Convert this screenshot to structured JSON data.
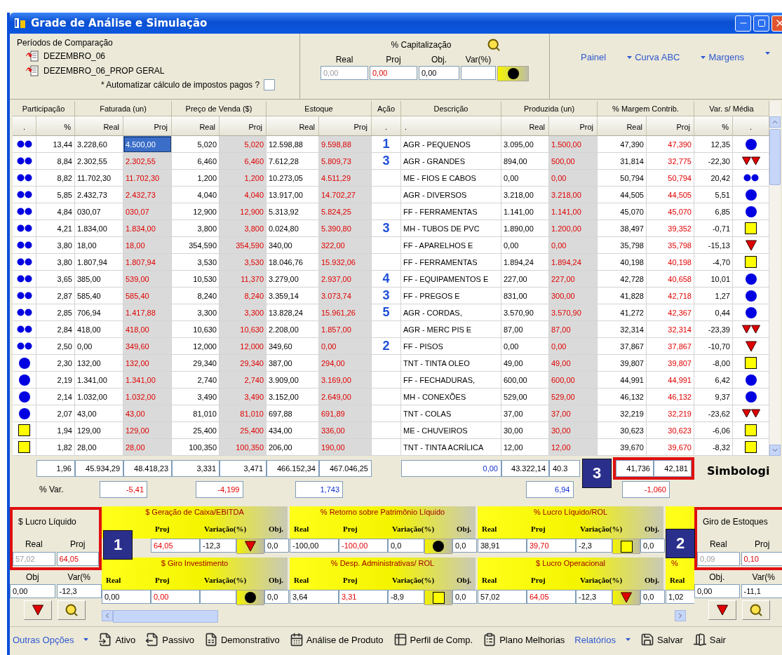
{
  "window": {
    "title": "Grade de Análise e Simulação"
  },
  "periods": {
    "title": "Períodos de Comparação",
    "items": [
      "DEZEMBRO_06",
      "DEZEMBRO_06_PROP GERAL"
    ],
    "auto_tax": {
      "label": "* Automatizar cálculo de impostos pagos ?",
      "checked": false
    }
  },
  "capitalization": {
    "title": "% Capitalização",
    "fields": [
      {
        "label": "Real",
        "value": "0,00",
        "kind": "muted"
      },
      {
        "label": "Proj",
        "value": "0,00",
        "kind": "negative"
      },
      {
        "label": "Obj.",
        "value": "0,00",
        "kind": "normal"
      },
      {
        "label": "Var(%)"
      }
    ],
    "signal": {
      "kind": "circle"
    }
  },
  "links": [
    {
      "label": "Painel",
      "dropdown": false
    },
    {
      "label": "Curva ABC",
      "dropdown": true
    },
    {
      "label": "Margens",
      "dropdown": true
    }
  ],
  "table": {
    "groups": [
      "Participação",
      "Faturada (un)",
      "Preço de Venda ($)",
      "Estoque",
      "Ação",
      "Descrição",
      "Produzida (un)",
      "% Margem Contrib.",
      "Var. s/ Média"
    ],
    "columns": [
      ".",
      "%",
      "Real",
      "Proj",
      "Real",
      "Proj",
      "Real",
      "Proj",
      ".",
      ".",
      "Real",
      "Proj",
      "Real",
      "Proj",
      "%",
      "."
    ],
    "rows": [
      {
        "participation": {
          "kind": "double-circle"
        },
        "share": "13,44",
        "faturada": [
          "3.228,60",
          "4.500,00"
        ],
        "preco": [
          "5,020",
          "5,020"
        ],
        "estoque": [
          "12.598,88",
          "9.598,88"
        ],
        "action": "1",
        "description": "AGR - PEQUENOS",
        "produzida": [
          "3.095,00",
          "1.500,00"
        ],
        "margem": [
          "47,390",
          "47,390"
        ],
        "variation": "12,35",
        "signal": {
          "kind": "circle"
        },
        "selected": true
      },
      {
        "participation": {
          "kind": "double-circle"
        },
        "share": "8,84",
        "faturada": [
          "2.302,55",
          "2.302,55"
        ],
        "preco": [
          "6,460",
          "6,460"
        ],
        "estoque": [
          "7.612,28",
          "5.809,73"
        ],
        "action": "3",
        "description": "AGR - GRANDES",
        "produzida": [
          "894,00",
          "500,00"
        ],
        "margem": [
          "31,814",
          "32,775"
        ],
        "variation": "-22,30",
        "signal": {
          "kind": "double-triangle"
        },
        "selected": false
      },
      {
        "participation": {
          "kind": "double-circle"
        },
        "share": "8,82",
        "faturada": [
          "11.702,30",
          "11.702,30"
        ],
        "preco": [
          "1,200",
          "1,200"
        ],
        "estoque": [
          "10.273,05",
          "4.511,29"
        ],
        "description": "ME - FIOS E CABOS",
        "produzida": [
          "0,00",
          "0,00"
        ],
        "margem": [
          "50,794",
          "50,794"
        ],
        "variation": "20,42",
        "signal": {
          "kind": "double-circle"
        },
        "selected": false
      },
      {
        "participation": {
          "kind": "double-circle"
        },
        "share": "5,85",
        "faturada": [
          "2.432,73",
          "2.432,73"
        ],
        "preco": [
          "4,040",
          "4,040"
        ],
        "estoque": [
          "13.917,00",
          "14.702,27"
        ],
        "description": "AGR - DIVERSOS",
        "produzida": [
          "3.218,00",
          "3.218,00"
        ],
        "margem": [
          "44,505",
          "44,505"
        ],
        "variation": "5,51",
        "signal": {
          "kind": "circle"
        },
        "selected": false
      },
      {
        "participation": {
          "kind": "double-circle"
        },
        "share": "4,84",
        "faturada": [
          "030,07",
          "030,07"
        ],
        "preco": [
          "12,900",
          "12,900"
        ],
        "estoque": [
          "5.313,92",
          "5.824,25"
        ],
        "description": "FF - FERRAMENTAS",
        "produzida": [
          "1.141,00",
          "1.141,00"
        ],
        "margem": [
          "45,070",
          "45,070"
        ],
        "variation": "6,85",
        "signal": {
          "kind": "circle"
        },
        "selected": false
      },
      {
        "participation": {
          "kind": "double-circle"
        },
        "share": "4,21",
        "faturada": [
          "1.834,00",
          "1.834,00"
        ],
        "preco": [
          "3,800",
          "3,800"
        ],
        "estoque": [
          "0.024,80",
          "5.390,80"
        ],
        "action": "3",
        "description": "MH - TUBOS DE PVC",
        "produzida": [
          "1.890,00",
          "1.200,00"
        ],
        "margem": [
          "38,497",
          "39,352"
        ],
        "variation": "-0,71",
        "signal": {
          "kind": "square"
        },
        "selected": false
      },
      {
        "participation": {
          "kind": "double-circle"
        },
        "share": "3,80",
        "faturada": [
          "18,00",
          "18,00"
        ],
        "preco": [
          "354,590",
          "354,590"
        ],
        "estoque": [
          "340,00",
          "322,00"
        ],
        "description": "FF - APARELHOS E",
        "produzida": [
          "0,00",
          "0,00"
        ],
        "margem": [
          "35,798",
          "35,798"
        ],
        "variation": "-15,13",
        "signal": {
          "kind": "triangle"
        },
        "selected": false
      },
      {
        "participation": {
          "kind": "double-circle"
        },
        "share": "3,80",
        "faturada": [
          "1.807,94",
          "1.807,94"
        ],
        "preco": [
          "3,530",
          "3,530"
        ],
        "estoque": [
          "18.046,76",
          "15.932,06"
        ],
        "description": "FF - FERRAMENTAS",
        "produzida": [
          "1.894,24",
          "1.894,24"
        ],
        "margem": [
          "40,198",
          "40,198"
        ],
        "variation": "-4,70",
        "signal": {
          "kind": "square"
        },
        "selected": false
      },
      {
        "participation": {
          "kind": "double-circle"
        },
        "share": "3,65",
        "faturada": [
          "385,00",
          "539,00"
        ],
        "preco": [
          "10,530",
          "11,370"
        ],
        "estoque": [
          "3.279,00",
          "2.937,00"
        ],
        "action": "4",
        "description": "FF - EQUIPAMENTOS E",
        "produzida": [
          "227,00",
          "227,00"
        ],
        "margem": [
          "42,728",
          "40,658"
        ],
        "variation": "10,01",
        "signal": {
          "kind": "circle"
        },
        "selected": false
      },
      {
        "participation": {
          "kind": "double-circle"
        },
        "share": "2,87",
        "faturada": [
          "585,40",
          "585,40"
        ],
        "preco": [
          "8,240",
          "8,240"
        ],
        "estoque": [
          "3.359,14",
          "3.073,74"
        ],
        "action": "3",
        "description": "FF - PREGOS E",
        "produzida": [
          "831,00",
          "300,00"
        ],
        "margem": [
          "41,828",
          "42,718"
        ],
        "variation": "1,27",
        "signal": {
          "kind": "circle"
        },
        "selected": false
      },
      {
        "participation": {
          "kind": "double-circle"
        },
        "share": "2,85",
        "faturada": [
          "706,94",
          "1.417,88"
        ],
        "preco": [
          "3,300",
          "3,300"
        ],
        "estoque": [
          "13.828,24",
          "15.961,26"
        ],
        "action": "5",
        "description": "AGR - CORDAS,",
        "produzida": [
          "3.570,90",
          "3.570,90"
        ],
        "margem": [
          "41,272",
          "42,367"
        ],
        "variation": "0,44",
        "signal": {
          "kind": "circle"
        },
        "selected": false
      },
      {
        "participation": {
          "kind": "double-circle"
        },
        "share": "2,84",
        "faturada": [
          "418,00",
          "418,00"
        ],
        "preco": [
          "10,630",
          "10,630"
        ],
        "estoque": [
          "2.208,00",
          "1.857,00"
        ],
        "description": "AGR - MERC PIS E",
        "produzida": [
          "87,00",
          "87,00"
        ],
        "margem": [
          "32,314",
          "32,314"
        ],
        "variation": "-23,39",
        "signal": {
          "kind": "double-triangle"
        },
        "selected": false
      },
      {
        "participation": {
          "kind": "double-circle"
        },
        "share": "2,50",
        "faturada": [
          "0,00",
          "349,60"
        ],
        "preco": [
          "12,000",
          "12,000"
        ],
        "estoque": [
          "349,60",
          "0,00"
        ],
        "action": "2",
        "description": "FF - PISOS",
        "produzida": [
          "0,00",
          "0,00"
        ],
        "margem": [
          "37,867",
          "37,867"
        ],
        "variation": "-10,70",
        "signal": {
          "kind": "triangle"
        },
        "selected": false
      },
      {
        "participation": {
          "kind": "circle"
        },
        "share": "2,30",
        "faturada": [
          "132,00",
          "132,00"
        ],
        "preco": [
          "29,340",
          "29,340"
        ],
        "estoque": [
          "387,00",
          "294,00"
        ],
        "description": "TNT - TINTA OLEO",
        "produzida": [
          "49,00",
          "49,00"
        ],
        "margem": [
          "39,807",
          "39,807"
        ],
        "variation": "-8,00",
        "signal": {
          "kind": "square"
        },
        "selected": false
      },
      {
        "participation": {
          "kind": "circle"
        },
        "share": "2,19",
        "faturada": [
          "1.341,00",
          "1.341,00"
        ],
        "preco": [
          "2,740",
          "2,740"
        ],
        "estoque": [
          "3.909,00",
          "3.169,00"
        ],
        "description": "FF - FECHADURAS,",
        "produzida": [
          "600,00",
          "600,00"
        ],
        "margem": [
          "44,991",
          "44,991"
        ],
        "variation": "6,42",
        "signal": {
          "kind": "circle"
        },
        "selected": false
      },
      {
        "participation": {
          "kind": "circle"
        },
        "share": "2,14",
        "faturada": [
          "1.032,00",
          "1.032,00"
        ],
        "preco": [
          "3,490",
          "3,490"
        ],
        "estoque": [
          "3.152,00",
          "2.649,00"
        ],
        "description": "MH - CONEXÕES",
        "produzida": [
          "529,00",
          "529,00"
        ],
        "margem": [
          "46,132",
          "46,132"
        ],
        "variation": "9,37",
        "signal": {
          "kind": "circle"
        },
        "selected": false
      },
      {
        "participation": {
          "kind": "circle"
        },
        "share": "2,07",
        "faturada": [
          "43,00",
          "43,00"
        ],
        "preco": [
          "81,010",
          "81,010"
        ],
        "estoque": [
          "697,88",
          "691,89"
        ],
        "description": "TNT - COLAS",
        "produzida": [
          "37,00",
          "37,00"
        ],
        "margem": [
          "32,219",
          "32,219"
        ],
        "variation": "-23,62",
        "signal": {
          "kind": "double-triangle"
        },
        "selected": false
      },
      {
        "participation": {
          "kind": "square"
        },
        "share": "1,94",
        "faturada": [
          "129,00",
          "129,00"
        ],
        "preco": [
          "25,400",
          "25,400"
        ],
        "estoque": [
          "434,00",
          "336,00"
        ],
        "description": "ME - CHUVEIROS",
        "produzida": [
          "30,00",
          "30,00"
        ],
        "margem": [
          "30,623",
          "30,623"
        ],
        "variation": "-6,06",
        "signal": {
          "kind": "square"
        },
        "selected": false
      },
      {
        "participation": {
          "kind": "square"
        },
        "share": "1,82",
        "faturada": [
          "28,00",
          "28,00"
        ],
        "preco": [
          "100,350",
          "100,350"
        ],
        "estoque": [
          "206,00",
          "190,00"
        ],
        "description": "TNT - TINTA ACRÍLICA",
        "produzida": [
          "12,00",
          "12,00"
        ],
        "margem": [
          "39,670",
          "39,670"
        ],
        "variation": "-8,32",
        "signal": {
          "kind": "square"
        },
        "selected": false
      }
    ]
  },
  "totals": {
    "share": "1,96",
    "faturada": [
      "45.934,29",
      "48.418,23"
    ],
    "preco": [
      "3,331",
      "3,471"
    ],
    "estoque": [
      "466.152,34",
      "467.046,25"
    ],
    "descricao": "0,00",
    "produzida": [
      "43.322,14",
      "40.3"
    ],
    "margem": [
      "41,736",
      "42,181"
    ],
    "margem_highlighted": true
  },
  "variation_row": {
    "label": "% Var.",
    "values": [
      {
        "text": "-5,41",
        "kind": "negative"
      },
      {
        "text": "-4,199",
        "kind": "negative"
      },
      {
        "text": "1,743",
        "kind": "positive"
      },
      {
        "text": "6,94",
        "kind": "positive"
      },
      {
        "text": "-1,060",
        "kind": "negative"
      }
    ]
  },
  "symbology": {
    "title": "Simbologi"
  },
  "net_profit": {
    "title": "$ Lucro Líquido",
    "highlighted": true,
    "labels": [
      "Real",
      "Proj",
      "Obj",
      "Var(%"
    ],
    "real": "57,02",
    "proj": "64,05",
    "objective": "0,00",
    "variation": "-12,3",
    "signal": {
      "kind": "triangle"
    }
  },
  "indicator_rows": [
    [
      {
        "kind": "metric",
        "title": "$ Geração de Caixa/EBITDA",
        "labels": {
          "proj": "Proj",
          "variation": "Variação(%)",
          "objective": "Obj."
        },
        "proj": "64,05",
        "variation": "-12,3",
        "signal": {
          "kind": "triangle"
        },
        "objective": "0,0"
      },
      {
        "kind": "metric",
        "title": "% Retorno sobre Patrimônio Líquido",
        "labels": {
          "real": "Real",
          "proj": "Proj",
          "variation": "Variação(%)",
          "objective": "Obj."
        },
        "real": "-100,00",
        "proj": "-100,00",
        "variation": "0,0",
        "signal": {
          "kind": "circle"
        },
        "objective": "0,0"
      },
      {
        "kind": "metric",
        "title": "% Lucro Líquido/ROL",
        "labels": {
          "real": "Real",
          "proj": "Proj",
          "variation": "Variação(%)",
          "objective": "Obj."
        },
        "real": "38,91",
        "proj": "39,70",
        "variation": "-2,3",
        "signal": {
          "kind": "square"
        },
        "objective": "0,0"
      },
      {
        "kind": "blank"
      }
    ],
    [
      {
        "kind": "metric",
        "title": "$ Giro Investimento",
        "labels": {
          "real": "Real",
          "proj": "Proj",
          "variation": "Variação(%)",
          "objective": "Obj."
        },
        "real": "0,00",
        "proj": "0,00",
        "signal": {
          "kind": "circle"
        },
        "objective": "0,0"
      },
      {
        "kind": "metric",
        "title": "% Desp. Administrativas/ ROL",
        "labels": {
          "real": "Real",
          "proj": "Proj",
          "variation": "Variação(%)",
          "objective": "Obj."
        },
        "real": "3,64",
        "proj": "3,31",
        "variation": "-8,9",
        "signal": {
          "kind": "square"
        },
        "objective": "0,0"
      },
      {
        "kind": "metric",
        "title": "$ Lucro Operacional",
        "labels": {
          "real": "Real",
          "proj": "Proj",
          "variation": "Variação(%)",
          "objective": "Obj."
        },
        "real": "57,02",
        "proj": "64,05",
        "variation": "-12,3",
        "signal": {
          "kind": "triangle"
        },
        "objective": "0,0"
      },
      {
        "kind": "partial",
        "title": "%",
        "labels": {
          "real": "Real"
        },
        "real": "1,02"
      }
    ]
  ],
  "stock_turnover": {
    "title": "Giro de Estoques",
    "highlighted": true,
    "labels": [
      "Real",
      "Proj",
      "Obj.",
      "Var(%"
    ],
    "real": "0,09",
    "proj": "0,10",
    "objective": "0,00",
    "variation": "-11,1",
    "signal": {
      "kind": "triangle"
    }
  },
  "callouts": [
    "1",
    "2",
    "3"
  ],
  "toolbar": [
    {
      "kind": "menu",
      "label": "Outras Opções"
    },
    {
      "kind": "tool",
      "label": "Ativo"
    },
    {
      "kind": "tool",
      "label": "Passivo"
    },
    {
      "kind": "tool",
      "label": "Demonstrativo"
    },
    {
      "kind": "tool",
      "label": "Análise de Produto"
    },
    {
      "kind": "tool",
      "label": "Perfil de Comp."
    },
    {
      "kind": "tool",
      "label": "Plano Melhorias"
    },
    {
      "kind": "menu",
      "label": "Relatórios"
    },
    {
      "kind": "tool",
      "label": "Salvar"
    },
    {
      "kind": "tool",
      "label": "Sair"
    }
  ]
}
